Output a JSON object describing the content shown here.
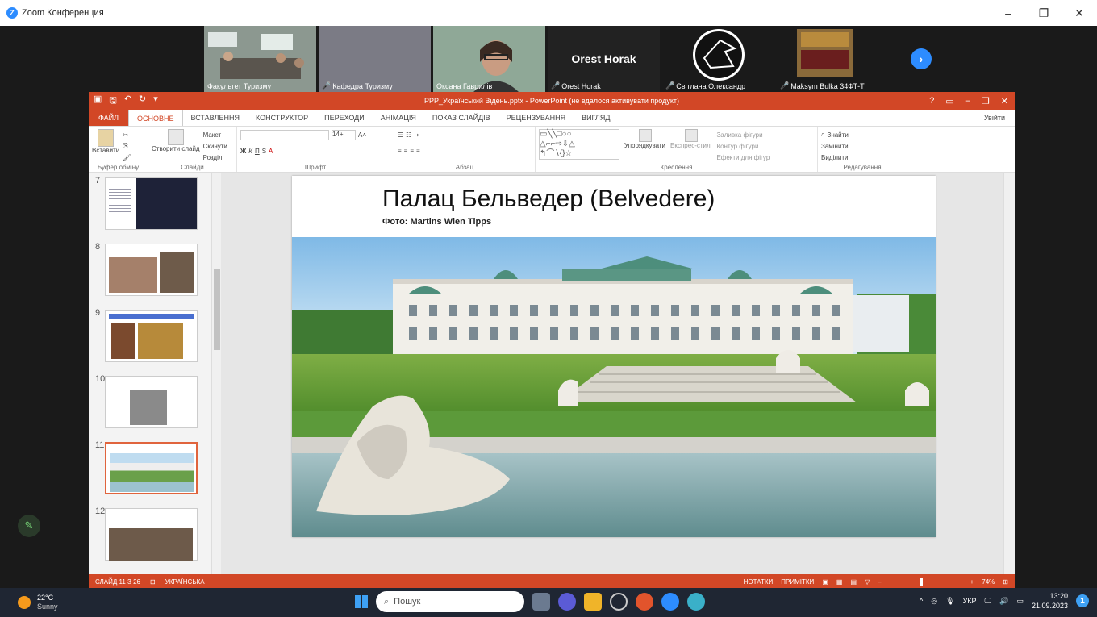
{
  "zoom": {
    "title": "Zoom Конференция",
    "participants": [
      {
        "name": "Факультет Туризму",
        "muted": false
      },
      {
        "name": "Кафедра Туризму",
        "muted": true
      },
      {
        "name": "Оксана Гаврилів",
        "muted": false
      },
      {
        "name": "Orest Horak",
        "muted": true,
        "display": "Orest Horak"
      },
      {
        "name": "Світлана Олександр",
        "muted": true
      },
      {
        "name": "Maksym Bulka 34ФТ-Т",
        "muted": true
      }
    ]
  },
  "ppt": {
    "doc_title": "PPP_Український Відень.pptx - PowerPoint (не вдалося активувати продукт)",
    "tabs": [
      "ФАЙЛ",
      "ОСНОВНЕ",
      "ВСТАВЛЕННЯ",
      "КОНСТРУКТОР",
      "ПЕРЕХОДИ",
      "АНІМАЦІЯ",
      "ПОКАЗ СЛАЙДІВ",
      "РЕЦЕНЗУВАННЯ",
      "ВИГЛЯД"
    ],
    "active_tab": "ОСНОВНЕ",
    "user_label": "Увійти",
    "ribbon": {
      "paste": "Вставити",
      "clipboard": "Буфер обміну",
      "new_slide": "Створити слайд",
      "layout": "Макет",
      "reset": "Скинути",
      "section": "Розділ",
      "slides": "Слайди",
      "font_group": "Шрифт",
      "font_size": "14+",
      "paragraph": "Абзац",
      "arrange": "Упорядкувати",
      "quick_styles": "Експрес-стилі",
      "shape_fill": "Заливка фігури",
      "shape_outline": "Контур фігури",
      "shape_effects": "Ефекти для фігур",
      "drawing": "Креслення",
      "find": "Знайти",
      "replace": "Замінити",
      "select": "Виділити",
      "editing": "Редагування"
    },
    "thumbnails": [
      "7",
      "8",
      "9",
      "10",
      "11",
      "12"
    ],
    "selected_slide": "11",
    "slide": {
      "title": "Палац Бельведер (Belvedere)",
      "caption": "Фото: Martins Wien Tipps"
    },
    "status": {
      "slide_count": "СЛАЙД 11 З 26",
      "language": "УКРАЇНСЬКА",
      "notes": "НОТАТКИ",
      "comments": "ПРИМІТКИ",
      "zoom": "74%"
    }
  },
  "taskbar": {
    "temperature": "22°C",
    "weather": "Sunny",
    "search_placeholder": "Пошук",
    "language": "УКР",
    "time": "13:20",
    "date": "21.09.2023"
  }
}
